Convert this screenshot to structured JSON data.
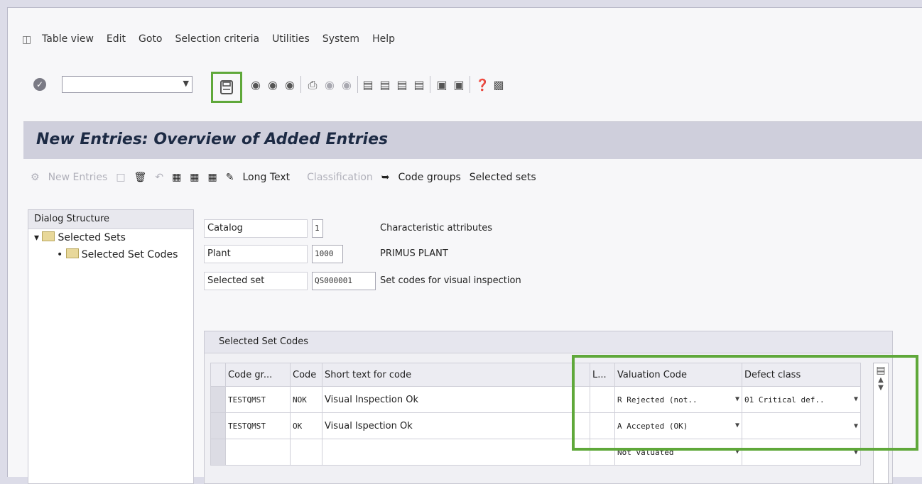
{
  "menu": [
    "Table view",
    "Edit",
    "Goto",
    "Selection criteria",
    "Utilities",
    "System",
    "Help"
  ],
  "header": {
    "title": "New Entries: Overview of Added Entries"
  },
  "app_toolbar": {
    "new_entries": "New Entries",
    "long_text": "Long Text",
    "classification": "Classification",
    "code_groups": "Code groups",
    "selected_sets": "Selected sets"
  },
  "dialog_structure": {
    "header": "Dialog Structure",
    "items": [
      {
        "label": "Selected Sets",
        "level": 1
      },
      {
        "label": "Selected Set Codes",
        "level": 2
      }
    ]
  },
  "fields": [
    {
      "label": "Catalog",
      "value": "1",
      "desc": "Characteristic attributes"
    },
    {
      "label": "Plant",
      "value": "1000",
      "desc": "PRIMUS PLANT"
    },
    {
      "label": "Selected set",
      "value": "QS000001",
      "desc": "Set codes for visual inspection"
    }
  ],
  "grid": {
    "title": "Selected Set Codes",
    "columns": [
      "Code gr...",
      "Code",
      "Short text for code",
      "L...",
      "Valuation Code",
      "Defect class"
    ],
    "rows": [
      {
        "code_group": "TESTQMST",
        "code": "NOK",
        "short_text": "Visual Inspection Ok",
        "l": "",
        "valuation": "R Rejected (not..",
        "defect": "01 Critical def.."
      },
      {
        "code_group": "TESTQMST",
        "code": "OK",
        "short_text": "Visual Ispection Ok",
        "l": "",
        "valuation": "A Accepted (OK)",
        "defect": ""
      },
      {
        "code_group": "",
        "code": "",
        "short_text": "",
        "l": "",
        "valuation": "Not valuated",
        "defect": ""
      }
    ]
  },
  "colors": {
    "highlight": "#5fa83a",
    "title_bg": "#cfcfdc",
    "title_text": "#1c2a44"
  }
}
